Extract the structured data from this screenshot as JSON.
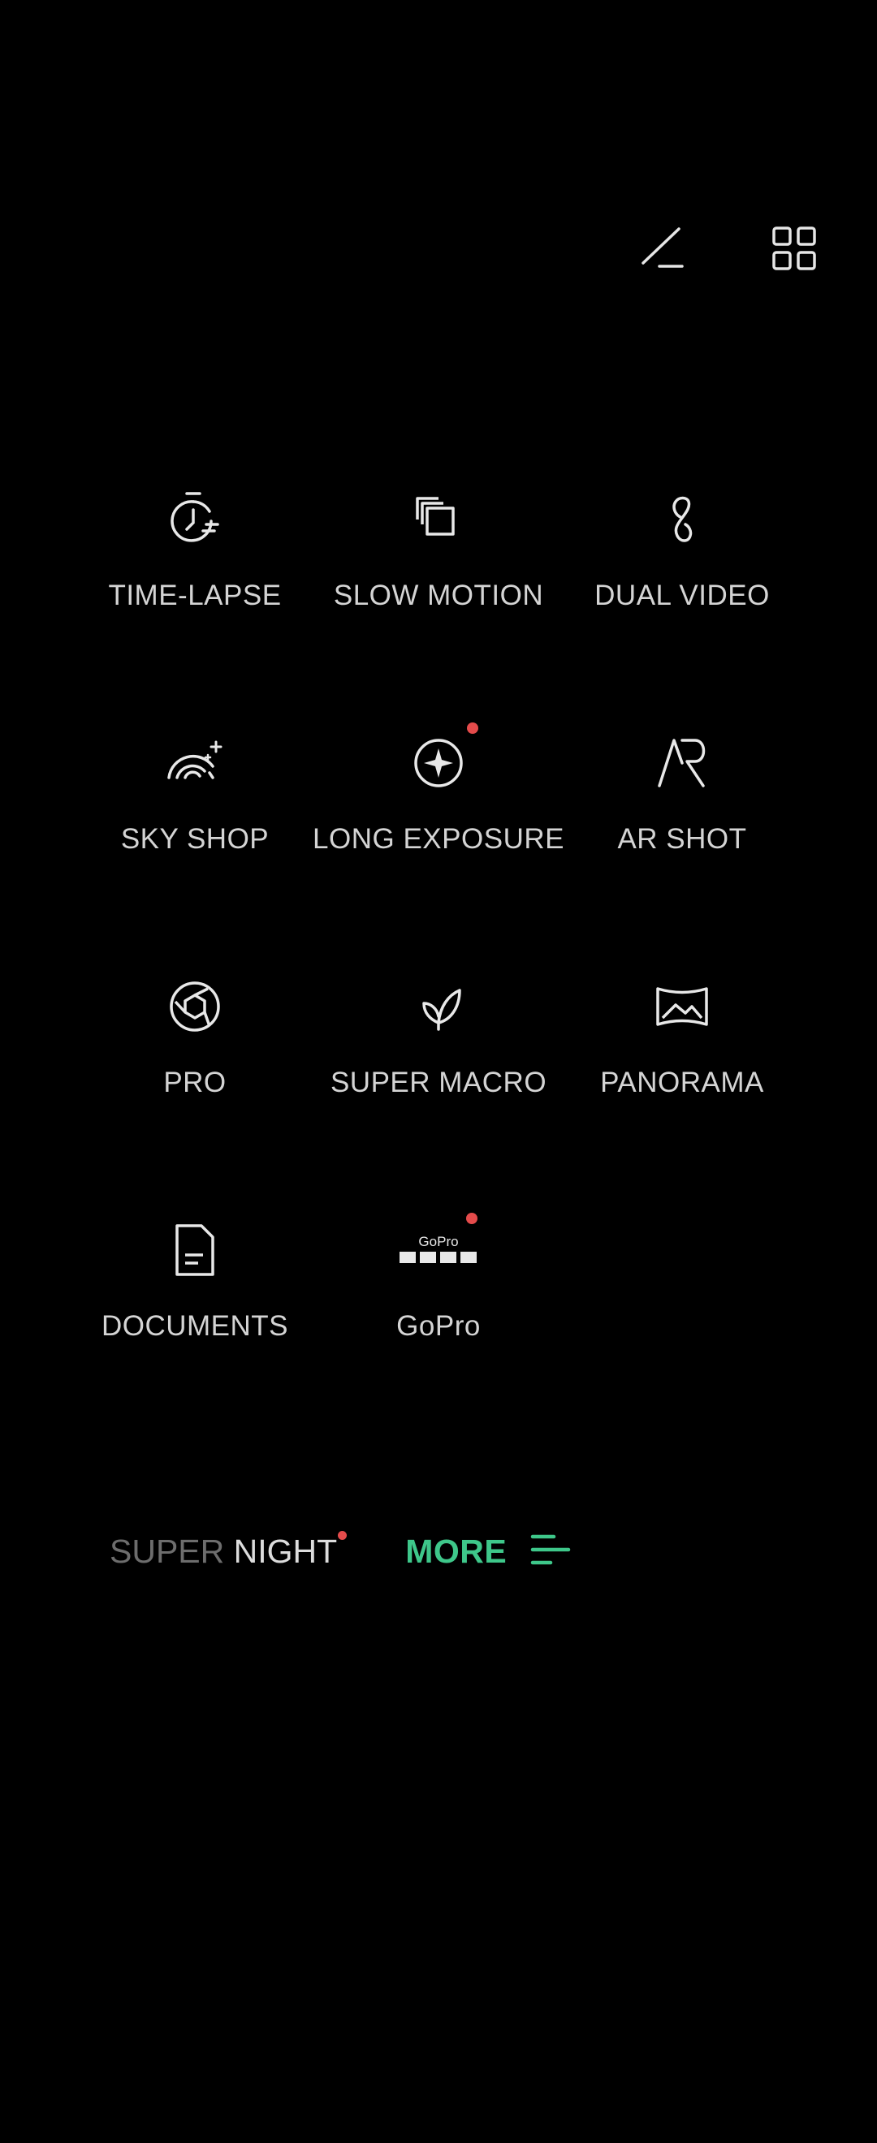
{
  "colors": {
    "background": "#000000",
    "label": "#d4d4d4",
    "accent": "#3ec78a",
    "notification_dot": "#e44b4b",
    "faded_text": "#6d6d6d"
  },
  "toolbar": {
    "edit_icon": "edit-pen-icon",
    "grid_icon": "grid-layout-icon"
  },
  "modes": [
    {
      "label": "TIME-LAPSE",
      "icon": "timer-icon",
      "has_dot": false
    },
    {
      "label": "SLOW MOTION",
      "icon": "layers-icon",
      "has_dot": false
    },
    {
      "label": "DUAL VIDEO",
      "icon": "dual-video-icon",
      "has_dot": false
    },
    {
      "label": "SKY SHOP",
      "icon": "rainbow-sparkle-icon",
      "has_dot": false
    },
    {
      "label": "LONG EXPOSURE",
      "icon": "star-circle-icon",
      "has_dot": true
    },
    {
      "label": "AR SHOT",
      "icon": "ar-icon",
      "has_dot": false
    },
    {
      "label": "PRO",
      "icon": "aperture-icon",
      "has_dot": false
    },
    {
      "label": "SUPER MACRO",
      "icon": "leaf-icon",
      "has_dot": false
    },
    {
      "label": "PANORAMA",
      "icon": "panorama-icon",
      "has_dot": false
    },
    {
      "label": "DOCUMENTS",
      "icon": "document-icon",
      "has_dot": false
    },
    {
      "label": "GoPro",
      "icon": "gopro-logo-icon",
      "has_dot": true,
      "logo_text": "GoPro"
    }
  ],
  "bottom": {
    "super_night_part1": "SUPER",
    "super_night_part2": " NIGHT",
    "super_night_has_dot": true,
    "more_label": "MORE",
    "more_icon": "menu-lines-icon"
  }
}
